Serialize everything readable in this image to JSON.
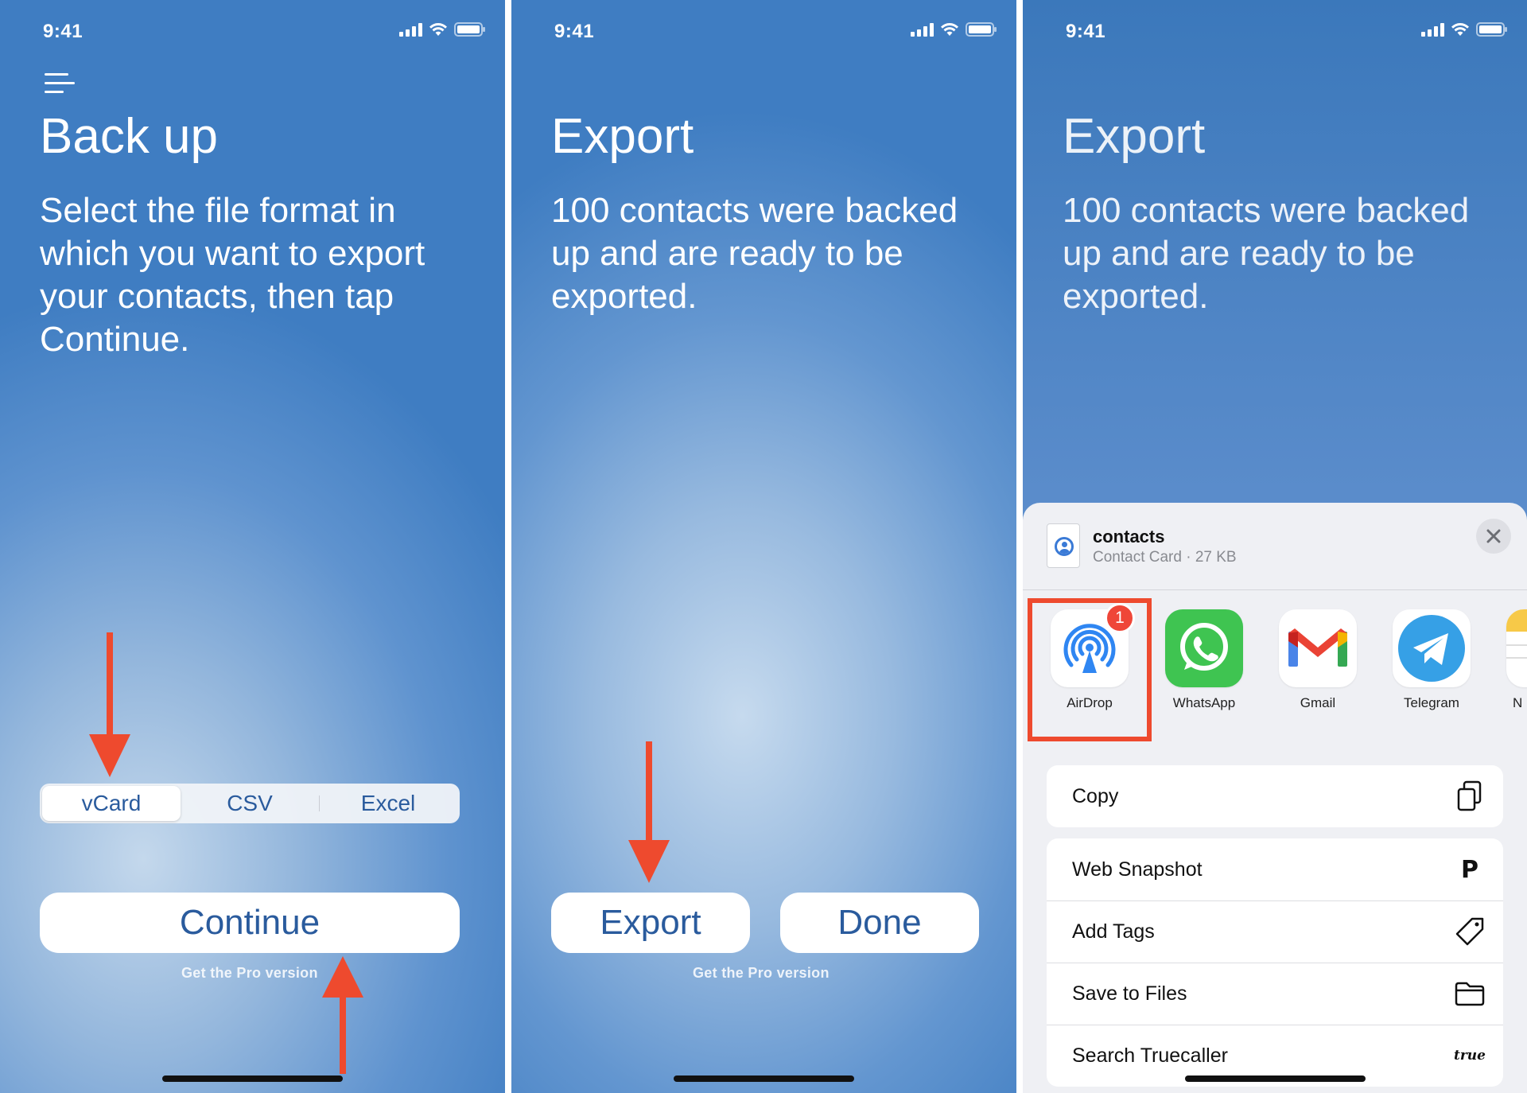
{
  "status_bar": {
    "time": "9:41"
  },
  "panel1": {
    "title": "Back up",
    "description": "Select the file format in which you want to export your contacts, then tap Continue.",
    "formats": [
      "vCard",
      "CSV",
      "Excel"
    ],
    "selected_format": "vCard",
    "continue_label": "Continue",
    "pro_label": "Get the Pro version"
  },
  "panel2": {
    "title": "Export",
    "description": "100 contacts were backed up and are ready to be exported.",
    "export_label": "Export",
    "done_label": "Done",
    "pro_label": "Get the Pro version"
  },
  "panel3": {
    "title": "Export",
    "description": "100 contacts were backed up and are ready to be exported.",
    "share_sheet": {
      "file_name": "contacts",
      "file_meta": "Contact Card · 27 KB",
      "apps": [
        {
          "label": "AirDrop",
          "icon": "airdrop-icon",
          "badge": "1"
        },
        {
          "label": "WhatsApp",
          "icon": "whatsapp-icon"
        },
        {
          "label": "Gmail",
          "icon": "gmail-icon"
        },
        {
          "label": "Telegram",
          "icon": "telegram-icon"
        },
        {
          "label": "N",
          "icon": "notes-icon"
        }
      ],
      "actions": [
        {
          "label": "Copy",
          "icon": "copy-icon"
        },
        {
          "label": "Web Snapshot",
          "icon": "pinterest-p-icon",
          "glyph": "P"
        },
        {
          "label": "Add Tags",
          "icon": "tag-icon"
        },
        {
          "label": "Save to Files",
          "icon": "folder-icon"
        },
        {
          "label": "Search Truecaller",
          "icon": "truecaller-icon",
          "glyph": "true"
        }
      ]
    }
  },
  "colors": {
    "accent_text": "#2a5b9d",
    "highlight_red": "#ee4a2e",
    "badge_red": "#ef4638"
  }
}
